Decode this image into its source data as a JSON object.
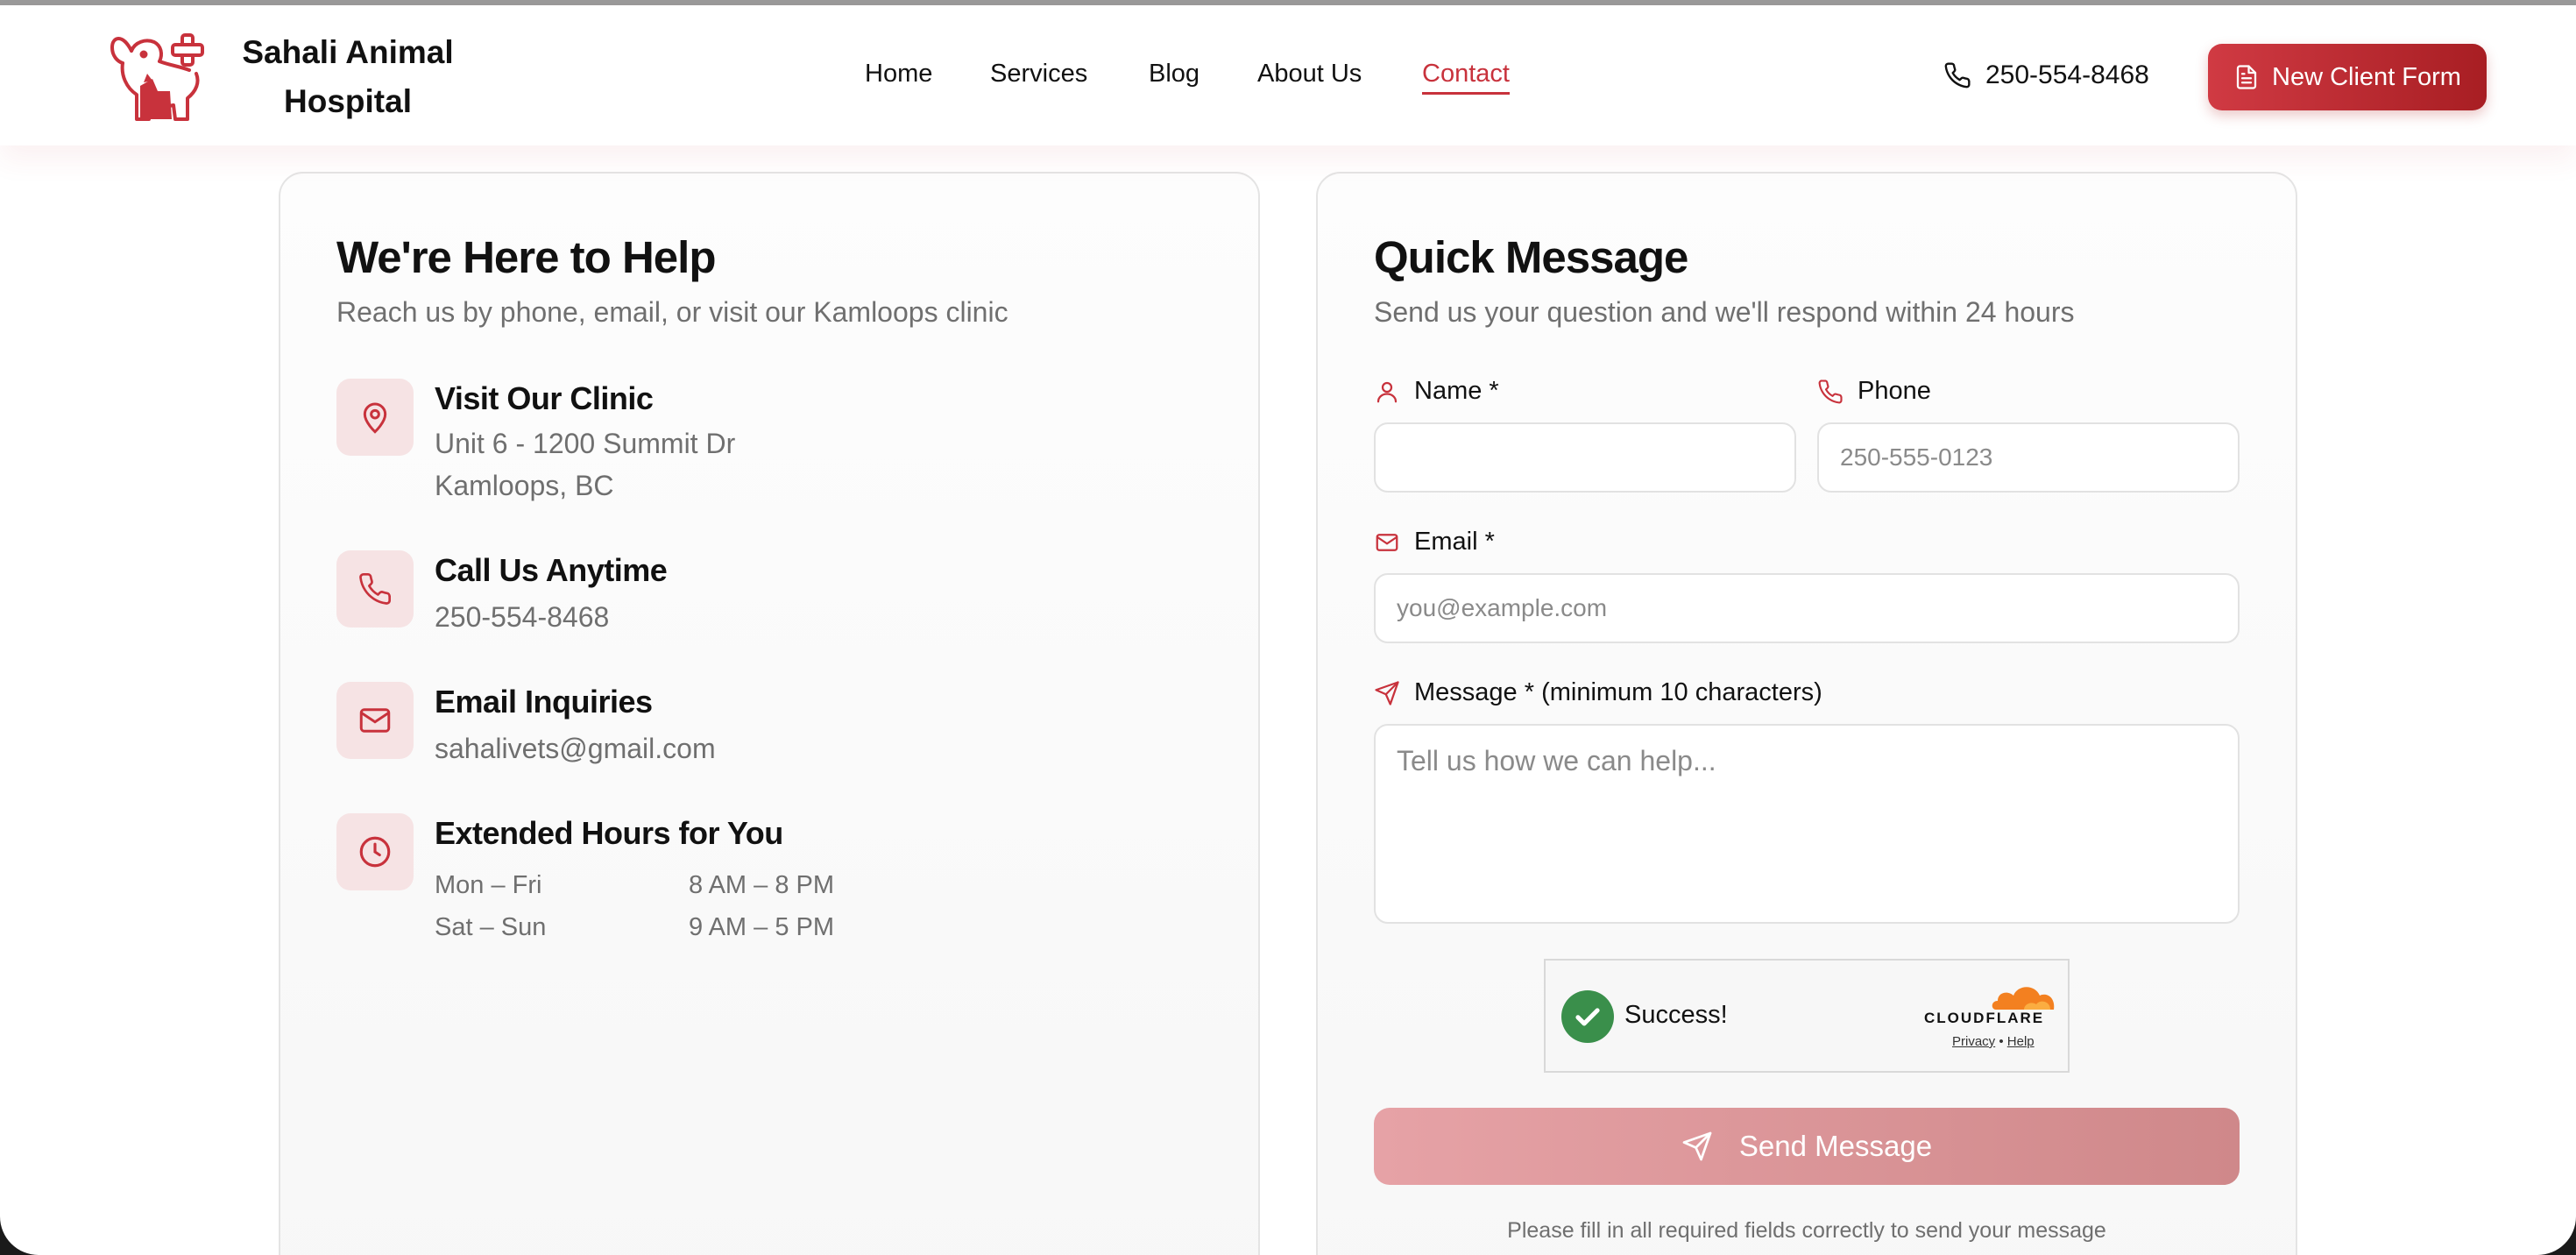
{
  "brand": {
    "name_line1": "Sahali Animal",
    "name_line2": "Hospital"
  },
  "nav": {
    "items": [
      {
        "label": "Home"
      },
      {
        "label": "Services"
      },
      {
        "label": "Blog"
      },
      {
        "label": "About Us"
      },
      {
        "label": "Contact",
        "active": true
      }
    ]
  },
  "header": {
    "phone": "250-554-8468",
    "cta_label": "New Client Form"
  },
  "contact_card": {
    "title": "We're Here to Help",
    "subtitle": "Reach us by phone, email, or visit our Kamloops clinic",
    "items": [
      {
        "icon": "map-pin-icon",
        "title": "Visit Our Clinic",
        "lines": [
          "Unit 6 - 1200 Summit Dr",
          "Kamloops, BC"
        ]
      },
      {
        "icon": "phone-icon",
        "title": "Call Us Anytime",
        "lines": [
          "250-554-8468"
        ]
      },
      {
        "icon": "mail-icon",
        "title": "Email Inquiries",
        "lines": [
          "sahalivets@gmail.com"
        ]
      },
      {
        "icon": "clock-icon",
        "title": "Extended Hours for You",
        "hours": [
          {
            "days": "Mon – Fri",
            "time": "8 AM – 8 PM"
          },
          {
            "days": "Sat – Sun",
            "time": "9 AM – 5 PM"
          }
        ]
      }
    ]
  },
  "form": {
    "title": "Quick Message",
    "subtitle": "Send us your question and we'll respond within 24 hours",
    "name_label": "Name *",
    "name_value": "",
    "phone_label": "Phone",
    "phone_placeholder": "250-555-0123",
    "email_label": "Email *",
    "email_placeholder": "you@example.com",
    "message_label": "Message * (minimum 10 characters)",
    "message_placeholder": "Tell us how we can help...",
    "captcha": {
      "status": "Success!",
      "provider": "CLOUDFLARE",
      "privacy_link": "Privacy",
      "separator": "•",
      "help_link": "Help"
    },
    "submit_label": "Send Message",
    "hint": "Please fill in all required fields correctly to send your message"
  },
  "colors": {
    "accent": "#c8323c",
    "accent_dark": "#a81e23",
    "icon_bg": "#f6e3e4",
    "success": "#3a8f4b",
    "cloudflare_orange": "#f38020"
  }
}
